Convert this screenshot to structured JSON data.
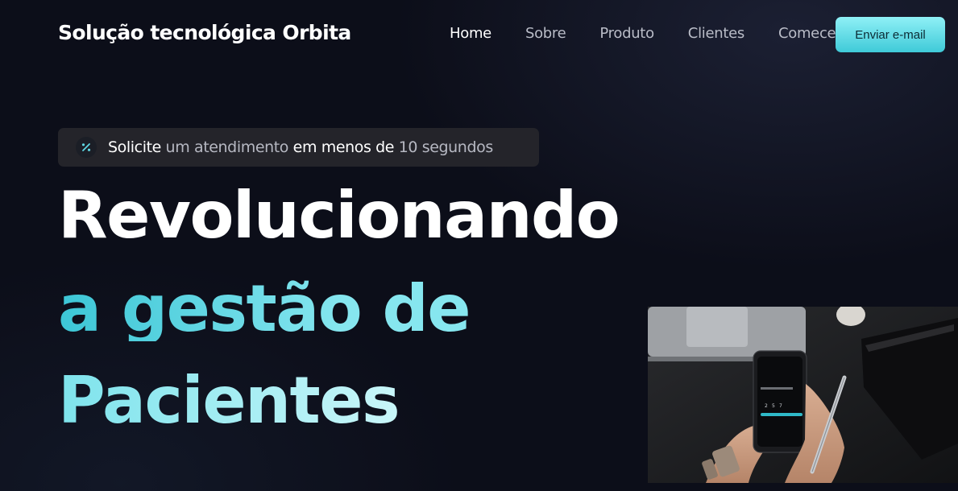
{
  "header": {
    "brand": "Solução tecnológica Orbita",
    "nav": [
      {
        "label": "Home",
        "active": true
      },
      {
        "label": "Sobre",
        "active": false
      },
      {
        "label": "Produto",
        "active": false
      },
      {
        "label": "Clientes",
        "active": false
      },
      {
        "label": "Comece",
        "active": false
      }
    ],
    "cta_label": "Enviar e-mail"
  },
  "badge": {
    "icon": "percent-icon",
    "parts": [
      "Solicite",
      " um atendimento",
      " em menos de",
      " 10 segundos"
    ]
  },
  "hero": {
    "line1": "Revolucionando",
    "line2": "a gestão de",
    "line3": "Pacientes"
  },
  "hero_image": {
    "icon": "phone-in-hands-photo",
    "phone_keys": [
      "2",
      "5",
      "7"
    ]
  },
  "colors": {
    "background": "#0c0e19",
    "accent": "#3fcad8",
    "accent_light": "#8ff0f6",
    "badge_bg": "#24242a"
  }
}
